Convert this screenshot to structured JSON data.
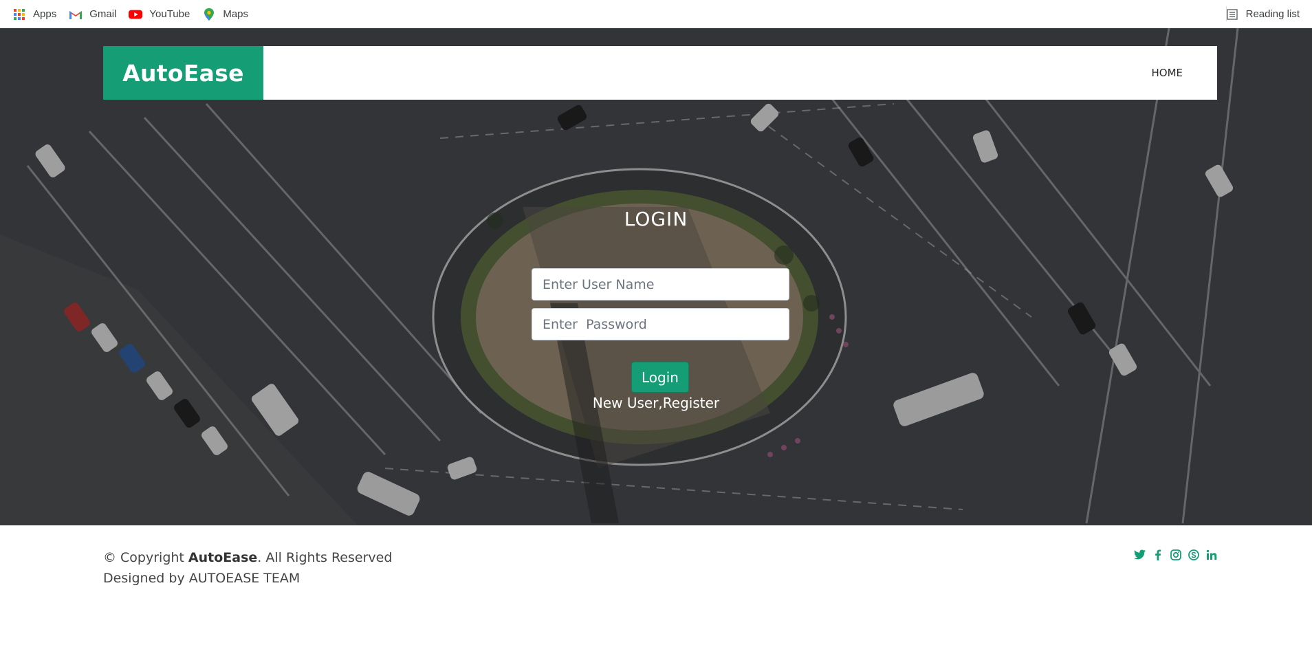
{
  "bookmarks": {
    "items": [
      {
        "label": "Apps",
        "icon": "apps-grid-icon"
      },
      {
        "label": "Gmail",
        "icon": "gmail-icon"
      },
      {
        "label": "YouTube",
        "icon": "youtube-icon"
      },
      {
        "label": "Maps",
        "icon": "maps-icon"
      }
    ],
    "reading_list": "Reading list"
  },
  "header": {
    "brand": "AutoEase",
    "nav": {
      "home": "HOME"
    }
  },
  "login": {
    "title": "LOGIN",
    "username_placeholder": "Enter User Name",
    "password_placeholder": "Enter  Password",
    "button": "Login",
    "register_link": "New User,Register"
  },
  "footer": {
    "copyright_prefix": "© Copyright ",
    "copyright_brand": "AutoEase",
    "copyright_suffix": ". All Rights Reserved",
    "designed_by": "Designed by AUTOEASE TEAM",
    "socials": [
      "twitter-icon",
      "facebook-icon",
      "instagram-icon",
      "skype-icon",
      "linkedin-icon"
    ]
  },
  "colors": {
    "accent": "#159e76",
    "hero_bg": "#3f4245"
  }
}
